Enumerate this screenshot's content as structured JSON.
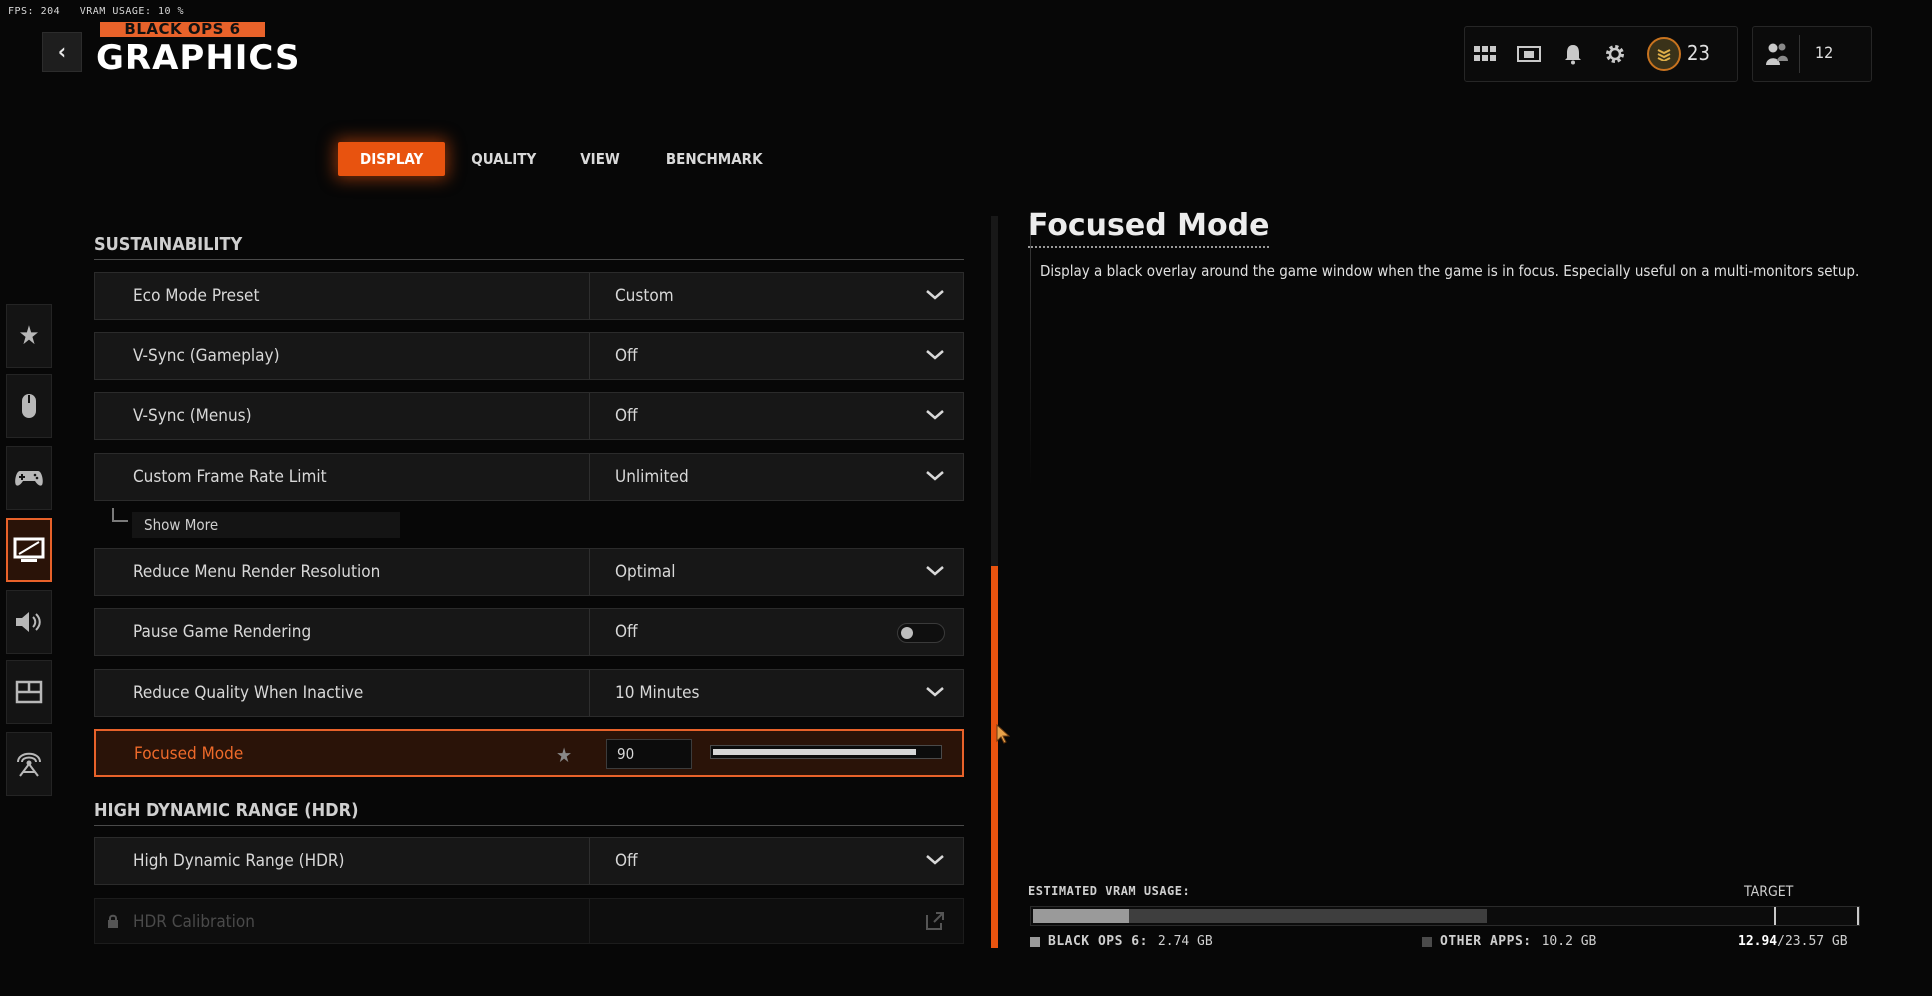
{
  "hud": {
    "fps": "FPS: 204",
    "vram": "VRAM USAGE: 10 %"
  },
  "header": {
    "logo_text": "BLACK OPS 6",
    "title": "GRAPHICS"
  },
  "topbar": {
    "icons": [
      "apps-grid-icon",
      "store-icon",
      "notification-bell-icon",
      "settings-gear-icon"
    ],
    "level": "23",
    "party_count": "12"
  },
  "tabs": [
    {
      "label": "DISPLAY",
      "active": true
    },
    {
      "label": "QUALITY",
      "active": false
    },
    {
      "label": "VIEW",
      "active": false
    },
    {
      "label": "BENCHMARK",
      "active": false
    }
  ],
  "sections": {
    "sustainability": "SUSTAINABILITY",
    "hdr": "HIGH DYNAMIC RANGE (HDR)"
  },
  "settings": {
    "eco_mode_preset": {
      "label": "Eco Mode Preset",
      "value": "Custom"
    },
    "vsync_gameplay": {
      "label": "V-Sync (Gameplay)",
      "value": "Off"
    },
    "vsync_menus": {
      "label": "V-Sync (Menus)",
      "value": "Off"
    },
    "custom_frame_rate_limit": {
      "label": "Custom Frame Rate Limit",
      "value": "Unlimited"
    },
    "show_more": "Show More",
    "reduce_menu_render_resolution": {
      "label": "Reduce Menu Render Resolution",
      "value": "Optimal"
    },
    "pause_game_rendering": {
      "label": "Pause Game Rendering",
      "value": "Off"
    },
    "reduce_quality_when_inactive": {
      "label": "Reduce Quality When Inactive",
      "value": "10 Minutes"
    },
    "focused_mode": {
      "label": "Focused Mode",
      "value": "90",
      "level": 0.9
    },
    "hdr": {
      "label": "High Dynamic Range (HDR)",
      "value": "Off"
    },
    "hdr_calibration": {
      "label": "HDR Calibration"
    }
  },
  "side_nav": [
    "favorites-star-icon",
    "mouse-icon",
    "controller-icon",
    "graphics-monitor-icon",
    "audio-speaker-icon",
    "interface-layout-icon",
    "network-icon"
  ],
  "description": {
    "title": "Focused Mode",
    "text": "Display a black overlay around the game window when the game is in focus. Especially useful on a multi-monitors setup."
  },
  "vram": {
    "label": "ESTIMATED VRAM USAGE:",
    "target_label": "TARGET",
    "game_label": "BLACK OPS 6:",
    "game_value": "2.74 GB",
    "other_label": "OTHER APPS:",
    "other_value": "10.2 GB",
    "total_used": "12.94",
    "total_rest": "/23.57 GB",
    "game_fraction": 0.116,
    "other_fraction": 0.433,
    "target_fraction": 0.9,
    "colors": {
      "game": "#9a9a9a",
      "other": "#3e3e3e"
    }
  },
  "colors": {
    "accent": "#e8622a"
  }
}
